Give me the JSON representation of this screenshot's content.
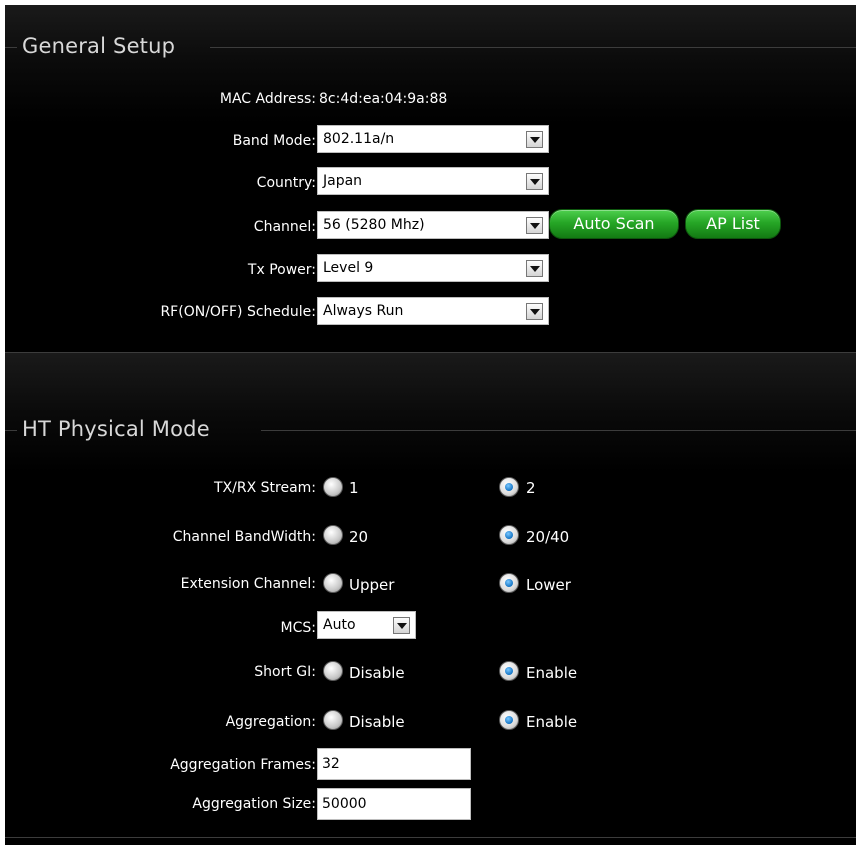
{
  "general": {
    "title": "General Setup",
    "mac_label": "MAC Address:",
    "mac_value": "8c:4d:ea:04:9a:88",
    "band_label": "Band Mode:",
    "band_value": "802.11a/n",
    "country_label": "Country:",
    "country_value": "Japan",
    "channel_label": "Channel:",
    "channel_value": "56 (5280 Mhz)",
    "auto_scan_label": "Auto Scan",
    "ap_list_label": "AP List",
    "tx_label": "Tx Power:",
    "tx_value": "Level 9",
    "rf_label": "RF(ON/OFF) Schedule:",
    "rf_value": "Always Run"
  },
  "ht": {
    "title": "HT Physical Mode",
    "stream_label": "TX/RX Stream:",
    "stream_opt1": "1",
    "stream_opt2": "2",
    "stream_selected": "2",
    "bw_label": "Channel BandWidth:",
    "bw_opt1": "20",
    "bw_opt2": "20/40",
    "bw_selected": "20/40",
    "ext_label": "Extension Channel:",
    "ext_opt1": "Upper",
    "ext_opt2": "Lower",
    "ext_selected": "Lower",
    "mcs_label": "MCS:",
    "mcs_value": "Auto",
    "gi_label": "Short GI:",
    "gi_opt1": "Disable",
    "gi_opt2": "Enable",
    "gi_selected": "Enable",
    "agg_label": "Aggregation:",
    "agg_opt1": "Disable",
    "agg_opt2": "Enable",
    "agg_selected": "Enable",
    "agg_frames_label": "Aggregation Frames:",
    "agg_frames_value": "32",
    "agg_size_label": "Aggregation Size:",
    "agg_size_value": "50000"
  },
  "colors": {
    "background": "#000000",
    "button_green": "#26a626",
    "radio_selected": "#1574c4"
  }
}
